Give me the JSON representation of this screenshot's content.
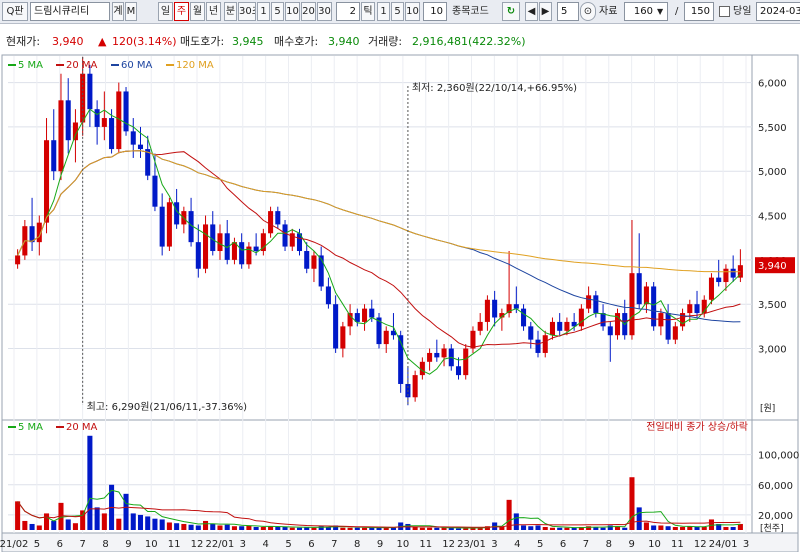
{
  "toolbar": {
    "btn_search": "Q판",
    "stock_name": "드림시큐리티",
    "btn_gi": "계",
    "btn_m": "M",
    "periods": [
      "일",
      "주",
      "월",
      "년"
    ],
    "selected_period": "주",
    "btn_bun": "분",
    "btn_30s": "30초",
    "intervals_1": [
      "1",
      "5",
      "10",
      "20",
      "30"
    ],
    "tick_value": "2",
    "btn_tick": "틱",
    "intervals_2": [
      "1",
      "5",
      "10"
    ],
    "intervals_2_value": "10",
    "code_label": "종목코드",
    "btn_refresh": "↻",
    "code_value": "5",
    "data_label": "자료",
    "data_count": "160",
    "slash": "/",
    "total_count": "150",
    "today_label": "당일",
    "date_value": "2024-03"
  },
  "info": {
    "price_label": "현재가:",
    "price": "3,940",
    "change_symbol": "▲",
    "change": "120(3.14%)",
    "ask_label": "매도호가:",
    "ask": "3,945",
    "bid_label": "매수호가:",
    "bid": "3,940",
    "volume_label": "거래량:",
    "volume": "2,916,481(422.32%)"
  },
  "colors": {
    "up": "#d40000",
    "down": "#0019c8",
    "ma5": "#17a817",
    "ma20": "#c21010",
    "ma60": "#1e45a0",
    "ma120": "#e0a020"
  },
  "chart_data": [
    {
      "type": "candlestick",
      "legend": [
        "5 MA",
        "20 MA",
        "60 MA",
        "120 MA"
      ],
      "ylim": [
        2250,
        6300
      ],
      "yticks": [
        "3,000",
        "3,500",
        "4,000",
        "4,500",
        "5,000",
        "5,500",
        "6,000"
      ],
      "xticks": [
        "21/02",
        "5",
        "6",
        "7",
        "8",
        "9",
        "10",
        "11",
        "12",
        "22/01",
        "3",
        "4",
        "5",
        "6",
        "7",
        "8",
        "9",
        "10",
        "11",
        "12",
        "23/01",
        "3",
        "4",
        "5",
        "6",
        "7",
        "8",
        "9",
        "10",
        "11",
        "12",
        "24/01",
        "3"
      ],
      "annotations": [
        {
          "text": "최저: 2,360원(22/10/14,+66.95%)"
        },
        {
          "text": "최고: 6,290원(21/06/11,-37.36%)"
        }
      ],
      "current_price_label": "3,940",
      "current_price": 3940,
      "unit_label": "[원]",
      "weekly_ohlc": [
        [
          3950,
          4120,
          3900,
          4050
        ],
        [
          4050,
          4450,
          4000,
          4380
        ],
        [
          4380,
          4700,
          4100,
          4200
        ],
        [
          4200,
          4500,
          4050,
          4420
        ],
        [
          4420,
          5600,
          4300,
          5350
        ],
        [
          5350,
          5700,
          4900,
          5000
        ],
        [
          5000,
          6100,
          4900,
          5800
        ],
        [
          5800,
          6050,
          5200,
          5350
        ],
        [
          5350,
          5700,
          5100,
          5550
        ],
        [
          5550,
          6290,
          5400,
          6100
        ],
        [
          6100,
          6200,
          5500,
          5700
        ],
        [
          5700,
          5800,
          5300,
          5500
        ],
        [
          5500,
          5900,
          5350,
          5600
        ],
        [
          5600,
          5700,
          5200,
          5250
        ],
        [
          5250,
          6000,
          5200,
          5900
        ],
        [
          5900,
          5950,
          5400,
          5450
        ],
        [
          5450,
          5600,
          5150,
          5300
        ],
        [
          5300,
          5500,
          5150,
          5250
        ],
        [
          5250,
          5400,
          4900,
          4950
        ],
        [
          4950,
          5200,
          4550,
          4600
        ],
        [
          4600,
          4750,
          4050,
          4150
        ],
        [
          4150,
          4700,
          4100,
          4650
        ],
        [
          4650,
          4800,
          4350,
          4400
        ],
        [
          4400,
          4600,
          4300,
          4550
        ],
        [
          4550,
          4700,
          4150,
          4200
        ],
        [
          4200,
          4400,
          3800,
          3900
        ],
        [
          3900,
          4500,
          3850,
          4400
        ],
        [
          4400,
          4550,
          4050,
          4100
        ],
        [
          4100,
          4400,
          4000,
          4300
        ],
        [
          4300,
          4450,
          3950,
          4000
        ],
        [
          4000,
          4250,
          3950,
          4200
        ],
        [
          4200,
          4300,
          3900,
          3950
        ],
        [
          3950,
          4200,
          3900,
          4150
        ],
        [
          4150,
          4300,
          4050,
          4100
        ],
        [
          4100,
          4350,
          4050,
          4300
        ],
        [
          4300,
          4600,
          4250,
          4550
        ],
        [
          4550,
          4600,
          4350,
          4400
        ],
        [
          4400,
          4450,
          4100,
          4150
        ],
        [
          4150,
          4350,
          4100,
          4300
        ],
        [
          4300,
          4350,
          4050,
          4100
        ],
        [
          4100,
          4200,
          3850,
          3900
        ],
        [
          3900,
          4100,
          3750,
          4050
        ],
        [
          4050,
          4150,
          3650,
          3700
        ],
        [
          3700,
          3800,
          3450,
          3500
        ],
        [
          3500,
          3600,
          2950,
          3000
        ],
        [
          3000,
          3300,
          2900,
          3250
        ],
        [
          3250,
          3500,
          3150,
          3400
        ],
        [
          3400,
          3450,
          3250,
          3300
        ],
        [
          3300,
          3500,
          3200,
          3450
        ],
        [
          3450,
          3550,
          3300,
          3350
        ],
        [
          3350,
          3400,
          3000,
          3050
        ],
        [
          3050,
          3250,
          2950,
          3200
        ],
        [
          3200,
          3400,
          3100,
          3150
        ],
        [
          3150,
          3200,
          2500,
          2600
        ],
        [
          2600,
          2800,
          2360,
          2450
        ],
        [
          2450,
          2750,
          2400,
          2700
        ],
        [
          2700,
          2900,
          2650,
          2850
        ],
        [
          2850,
          3000,
          2750,
          2950
        ],
        [
          2950,
          3100,
          2850,
          2900
        ],
        [
          2900,
          3050,
          2800,
          3000
        ],
        [
          3000,
          3050,
          2750,
          2800
        ],
        [
          2800,
          2900,
          2650,
          2700
        ],
        [
          2700,
          3050,
          2650,
          3000
        ],
        [
          3000,
          3250,
          2950,
          3200
        ],
        [
          3200,
          3400,
          3150,
          3300
        ],
        [
          3300,
          3600,
          3200,
          3550
        ],
        [
          3550,
          3650,
          3250,
          3350
        ],
        [
          3350,
          3450,
          3200,
          3400
        ],
        [
          3400,
          4100,
          3350,
          3500
        ],
        [
          3500,
          3700,
          3400,
          3450
        ],
        [
          3450,
          3500,
          3200,
          3250
        ],
        [
          3250,
          3300,
          3000,
          3100
        ],
        [
          3100,
          3200,
          2900,
          2950
        ],
        [
          2950,
          3200,
          2900,
          3150
        ],
        [
          3150,
          3350,
          3100,
          3300
        ],
        [
          3300,
          3400,
          3150,
          3200
        ],
        [
          3200,
          3350,
          3150,
          3300
        ],
        [
          3300,
          3400,
          3200,
          3250
        ],
        [
          3250,
          3500,
          3200,
          3450
        ],
        [
          3450,
          3700,
          3400,
          3600
        ],
        [
          3600,
          3650,
          3350,
          3400
        ],
        [
          3400,
          3500,
          3200,
          3250
        ],
        [
          3250,
          3300,
          2850,
          3150
        ],
        [
          3150,
          3450,
          3100,
          3400
        ],
        [
          3400,
          3550,
          3100,
          3150
        ],
        [
          3150,
          4450,
          3100,
          3850
        ],
        [
          3850,
          4300,
          3450,
          3500
        ],
        [
          3500,
          3750,
          3400,
          3700
        ],
        [
          3700,
          3750,
          3200,
          3250
        ],
        [
          3250,
          3450,
          3150,
          3400
        ],
        [
          3400,
          3500,
          3050,
          3100
        ],
        [
          3100,
          3300,
          3050,
          3250
        ],
        [
          3250,
          3450,
          3200,
          3400
        ],
        [
          3400,
          3550,
          3300,
          3500
        ],
        [
          3500,
          3650,
          3350,
          3400
        ],
        [
          3400,
          3600,
          3350,
          3550
        ],
        [
          3550,
          3850,
          3500,
          3800
        ],
        [
          3800,
          4000,
          3700,
          3750
        ],
        [
          3750,
          3950,
          3650,
          3900
        ],
        [
          3900,
          4050,
          3750,
          3800
        ],
        [
          3800,
          4120,
          3750,
          3940
        ]
      ]
    },
    {
      "type": "bar",
      "legend": [
        "5 MA",
        "20 MA"
      ],
      "note": "전일대비 종가 상승/하락",
      "ylim": [
        0,
        130000
      ],
      "yticks": [
        "20,000",
        "60,000",
        "100,000"
      ],
      "unit_label": "[천주]",
      "volume_thousands": [
        38000,
        12000,
        8000,
        6000,
        22000,
        12000,
        36000,
        14000,
        9000,
        26000,
        125000,
        30000,
        22000,
        60000,
        15000,
        48000,
        22000,
        20000,
        18000,
        15000,
        14000,
        10000,
        9000,
        8000,
        7000,
        6000,
        12000,
        8000,
        6000,
        7000,
        5000,
        5000,
        6000,
        4000,
        4000,
        5000,
        4000,
        4000,
        3000,
        3000,
        4000,
        3000,
        5000,
        4000,
        6000,
        3000,
        3000,
        3000,
        3000,
        4000,
        3000,
        3000,
        3000,
        10000,
        8000,
        4000,
        3000,
        3000,
        3000,
        3000,
        3000,
        2000,
        2000,
        3000,
        4000,
        5000,
        10000,
        4000,
        40000,
        22000,
        6000,
        5000,
        6000,
        4000,
        3000,
        3000,
        3000,
        3000,
        4000,
        5000,
        4000,
        3000,
        6000,
        5000,
        3000,
        70000,
        30000,
        10000,
        6000,
        6000,
        5000,
        4000,
        4000,
        5000,
        4000,
        4000,
        14000,
        8000,
        4000,
        4000,
        8000
      ]
    }
  ]
}
